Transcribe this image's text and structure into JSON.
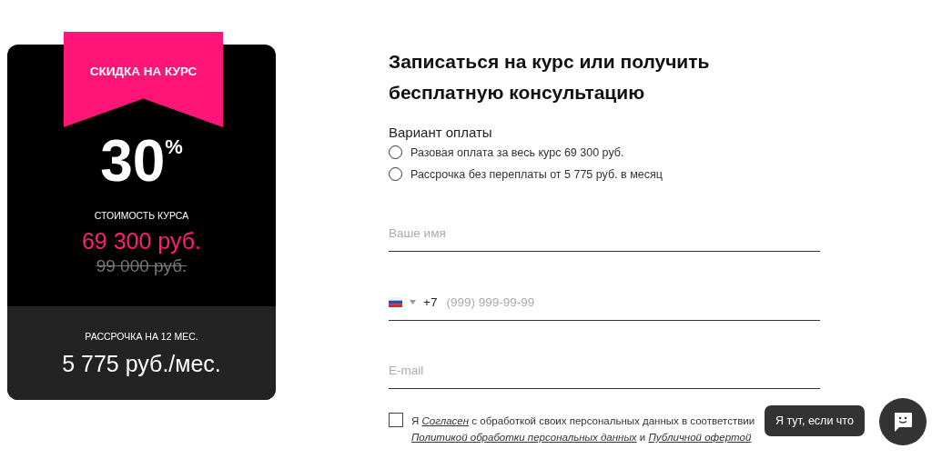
{
  "offer": {
    "ribbon": "СКИДКА НА КУРС",
    "discount": "30",
    "discount_unit": "%",
    "price_label": "СТОИМОСТЬ КУРСА",
    "price": "69 300 руб.",
    "old_price": "99 000 руб.",
    "installment_label": "РАССРОЧКА НА 12 МЕС.",
    "installment": "5 775 руб./мес."
  },
  "form": {
    "title": "Записаться на курс или получить бесплатную консультацию",
    "payment_label": "Вариант оплаты",
    "payment_options": [
      {
        "label": "Разовая оплата за весь курс 69 300 руб.",
        "selected": false
      },
      {
        "label": "Рассрочка без переплаты от 5 775 руб. в месяц",
        "selected": false
      }
    ],
    "name_field": {
      "placeholder": "Ваше имя"
    },
    "phone_field": {
      "prefix": "+7",
      "placeholder": "(999) 999-99-99"
    },
    "email_field": {
      "placeholder": "E-mail"
    },
    "consent": {
      "checked": false,
      "parts": [
        {
          "text": "Я "
        },
        {
          "text": "Согласен",
          "link": true
        },
        {
          "text": " с обработкой своих персональных данных в соответствии "
        },
        {
          "text": "Политикой обработки персональных данных",
          "link": true
        },
        {
          "text": " и "
        },
        {
          "text": "Публичной офертой",
          "link": true
        }
      ]
    }
  },
  "chat": {
    "tooltip": "Я тут, если что"
  }
}
